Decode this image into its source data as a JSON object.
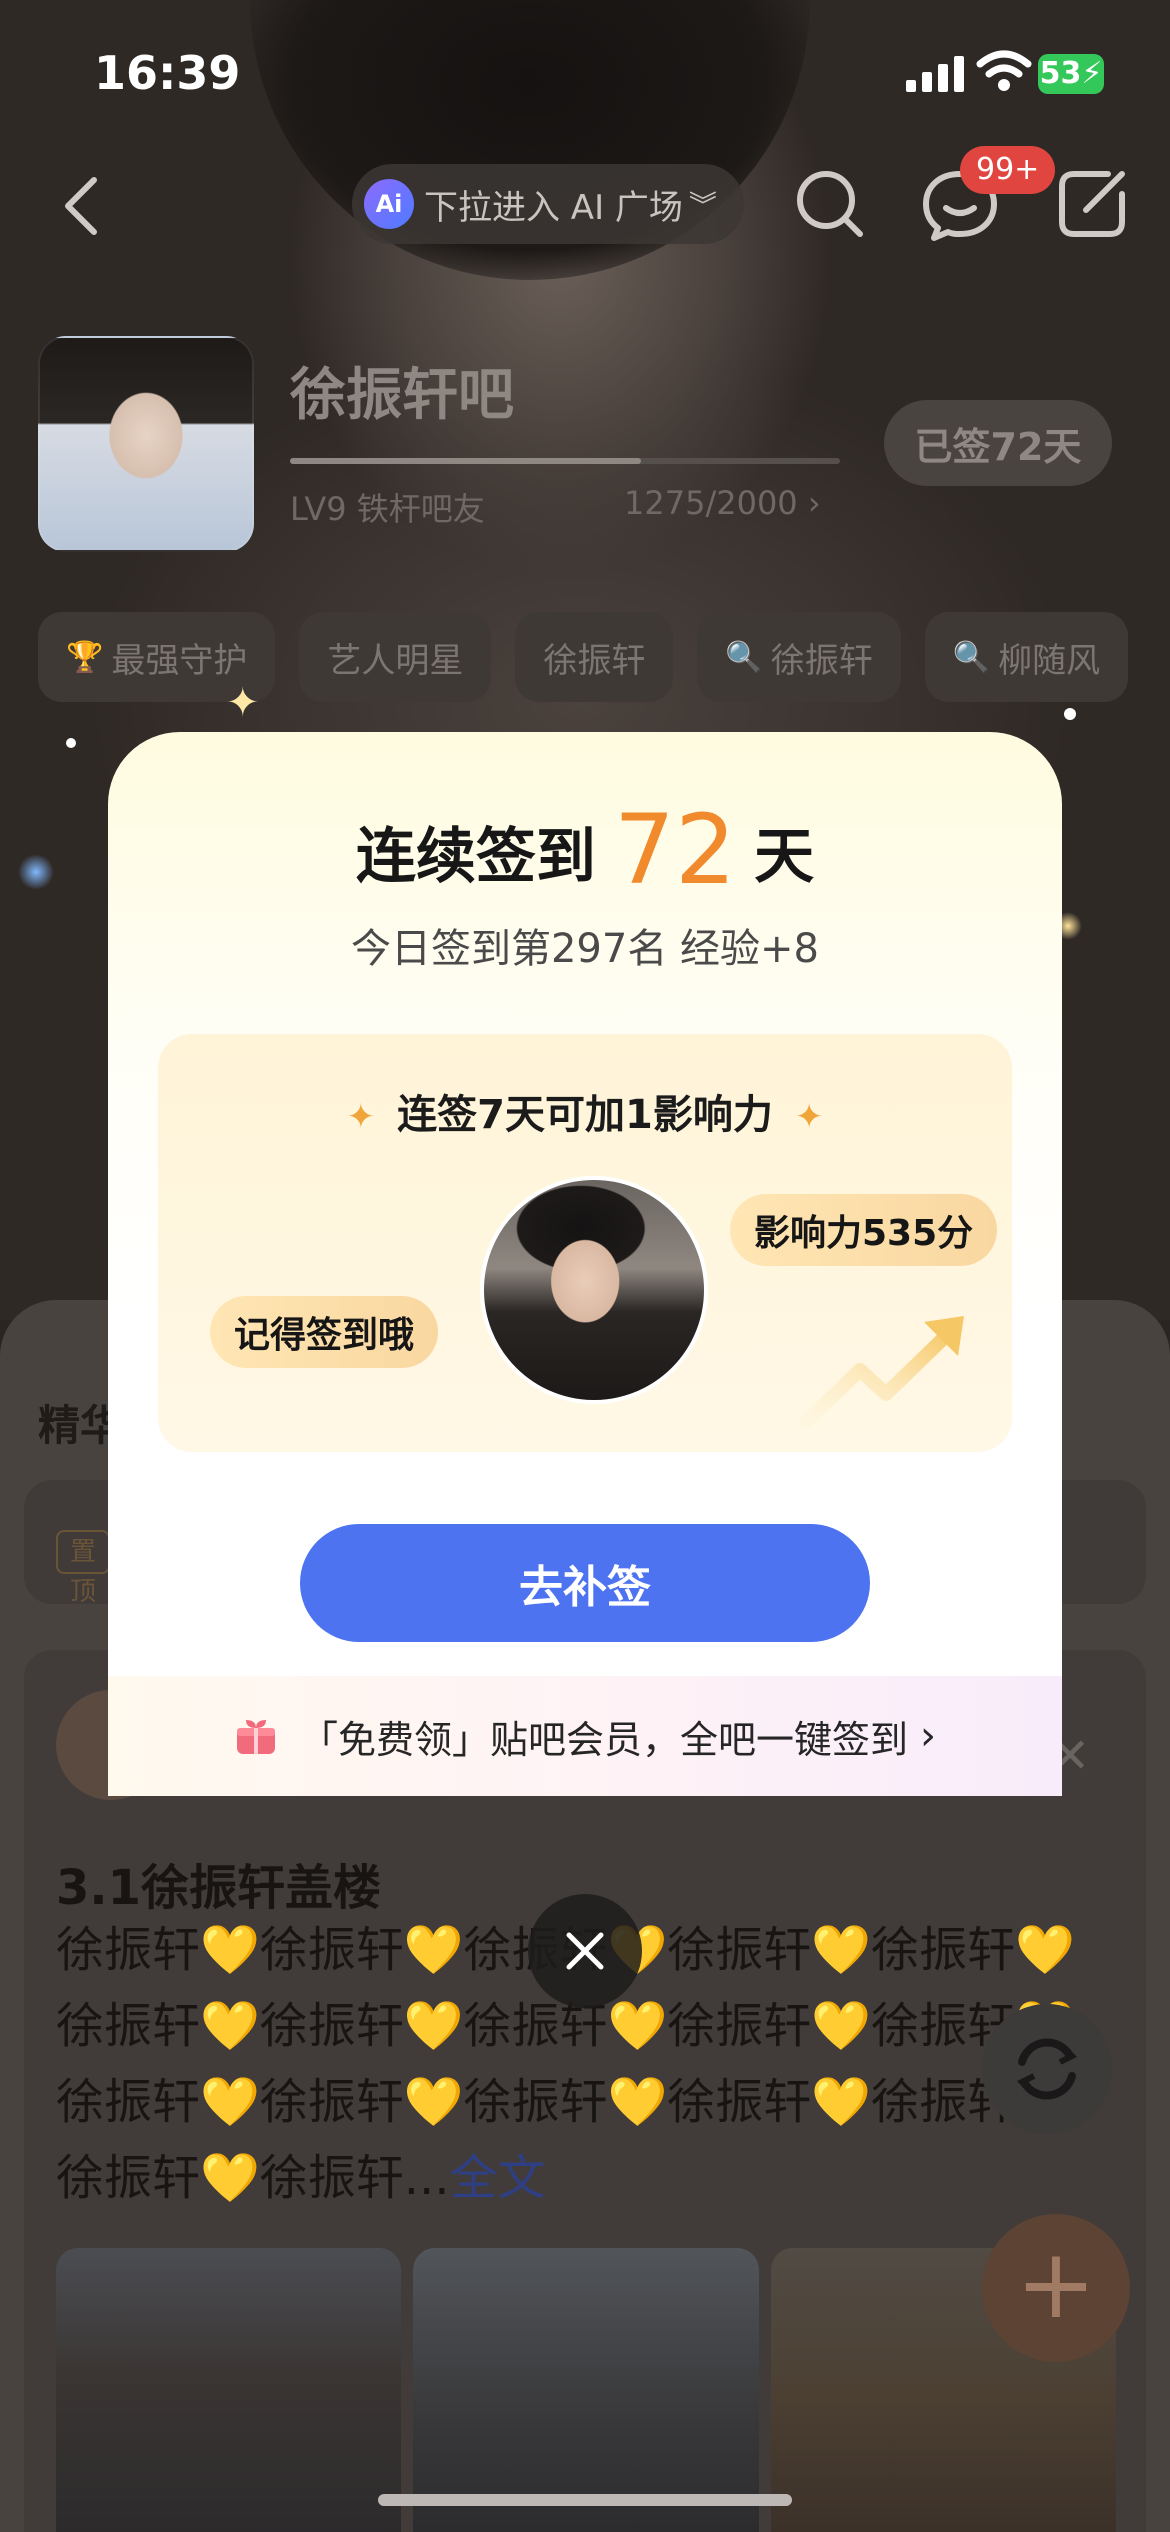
{
  "status_bar": {
    "time": "16:39",
    "battery": "53"
  },
  "top_nav": {
    "ai_logo": "Ai",
    "ai_entry": "下拉进入 AI 广场",
    "message_badge": "99+"
  },
  "forum": {
    "name": "徐振轩吧",
    "level": "LV9 铁杆吧友",
    "exp_progress": "1275/2000 ›",
    "exp_current": 1275,
    "exp_total": 2000,
    "signed_days": "已签72天"
  },
  "tags": [
    {
      "icon": "trophy-icon",
      "label": "最强守护"
    },
    {
      "icon": "",
      "label": "艺人明星"
    },
    {
      "icon": "",
      "label": "徐振轩"
    },
    {
      "icon": "search-icon",
      "label": "徐振轩"
    },
    {
      "icon": "search-icon",
      "label": "柳随风"
    }
  ],
  "modal": {
    "streak_prefix": "连续签到",
    "streak_days": "72",
    "streak_suffix": "天",
    "today_rank": "今日签到第297名 经验+8",
    "box_title": "连签7天可加1影响力",
    "bubble_left": "记得签到哦",
    "bubble_right": "影响力535分",
    "button": "去补签",
    "footer": "「免费领」贴吧会员，全吧一键签到",
    "footer_chevron": "›"
  },
  "feed": {
    "section_title": "精华",
    "pin_tag": "置顶",
    "post_title": "3.1徐振轩盖楼",
    "post_body": "徐振轩💛徐振轩💛徐振轩💛徐振轩💛徐振轩💛徐振轩💛徐振轩💛徐振轩💛徐振轩💛徐振轩💛徐振轩💛徐振轩💛徐振轩💛徐振轩💛徐振轩💛徐振轩💛徐振轩...",
    "more": "全文"
  },
  "colors": {
    "accent_orange": "#f08a2c",
    "button_blue": "#4d73f0",
    "badge_red": "#e0453f"
  }
}
